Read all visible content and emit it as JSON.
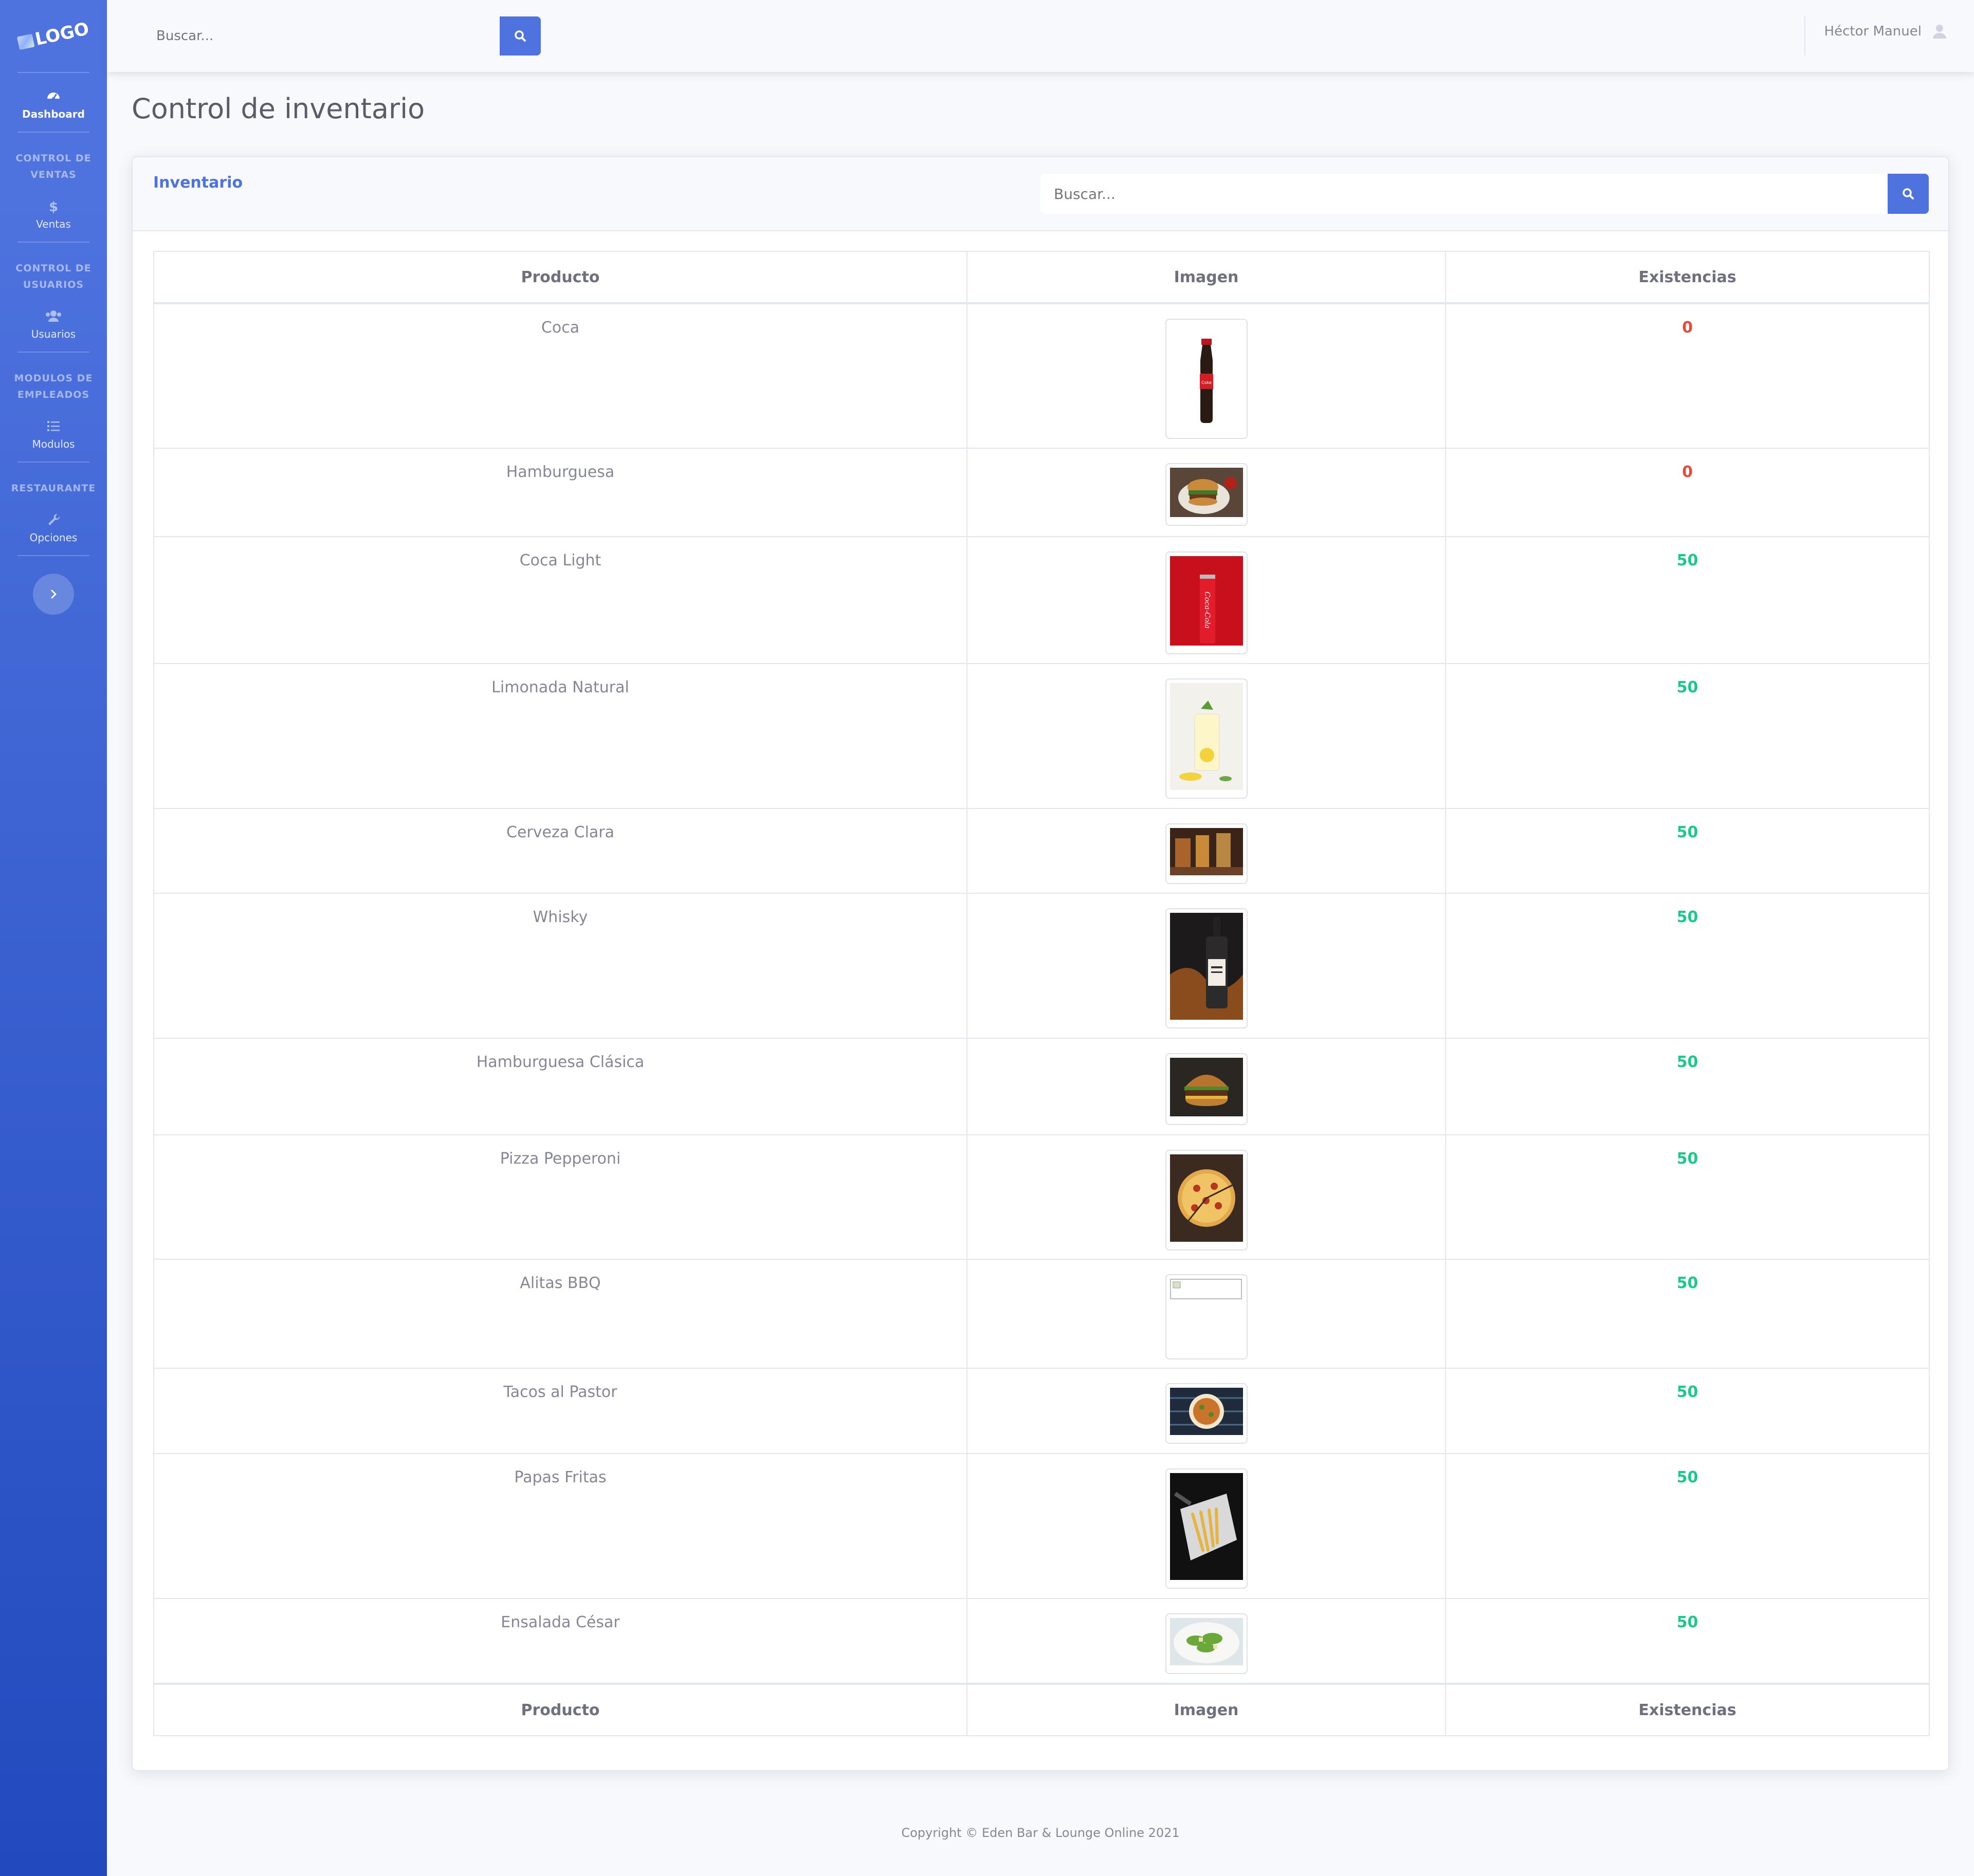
{
  "brand": {
    "logo_text": "LOGO"
  },
  "sidebar": {
    "dashboard": "Dashboard",
    "sections": [
      {
        "heading": "CONTROL DE VENTAS",
        "item": "Ventas",
        "icon": "dollar-icon"
      },
      {
        "heading": "CONTROL DE USUARIOS",
        "item": "Usuarios",
        "icon": "users-icon"
      },
      {
        "heading": "MODULOS DE EMPLEADOS",
        "item": "Modulos",
        "icon": "list-icon"
      },
      {
        "heading": "RESTAURANTE",
        "item": "Opciones",
        "icon": "wrench-icon"
      }
    ]
  },
  "topbar": {
    "search_placeholder": "Buscar...",
    "user_name": "Héctor Manuel"
  },
  "page": {
    "title": "Control de inventario"
  },
  "card": {
    "title": "Inventario",
    "search_placeholder": "Buscar..."
  },
  "table": {
    "headers": [
      "Producto",
      "Imagen",
      "Existencias"
    ],
    "rows": [
      {
        "product": "Coca",
        "stock": "0",
        "image": "coke-bottle"
      },
      {
        "product": "Hamburguesa",
        "stock": "0",
        "image": "burger-plate"
      },
      {
        "product": "Coca Light",
        "stock": "50",
        "image": "coke-can"
      },
      {
        "product": "Limonada Natural",
        "stock": "50",
        "image": "lemonade"
      },
      {
        "product": "Cerveza Clara",
        "stock": "50",
        "image": "beer"
      },
      {
        "product": "Whisky",
        "stock": "50",
        "image": "whisky-bottle"
      },
      {
        "product": "Hamburguesa Clásica",
        "stock": "50",
        "image": "classic-burger"
      },
      {
        "product": "Pizza Pepperoni",
        "stock": "50",
        "image": "pizza"
      },
      {
        "product": "Alitas BBQ",
        "stock": "50",
        "image": "broken-image"
      },
      {
        "product": "Tacos al Pastor",
        "stock": "50",
        "image": "tacos"
      },
      {
        "product": "Papas Fritas",
        "stock": "50",
        "image": "fries"
      },
      {
        "product": "Ensalada César",
        "stock": "50",
        "image": "salad"
      }
    ]
  },
  "footer": {
    "text": "Copyright © Eden Bar & Lounge Online 2021"
  },
  "colors": {
    "primary": "#4e73df",
    "danger": "#e74a3b",
    "success": "#1cc88a"
  }
}
